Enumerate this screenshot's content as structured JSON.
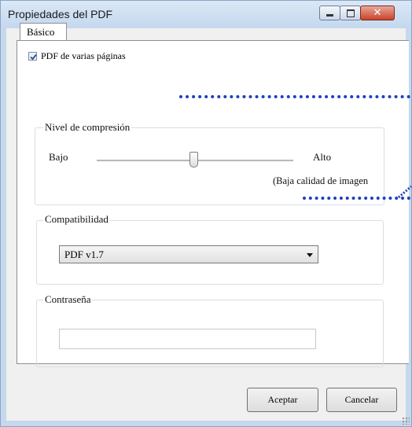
{
  "window": {
    "title": "Propiedades del PDF"
  },
  "tabs": [
    {
      "label": "Básico"
    }
  ],
  "multipage": {
    "label": "PDF de varias páginas",
    "checked": true
  },
  "compression": {
    "legend": "Nivel de compresión",
    "low_label": "Bajo",
    "high_label": "Alto",
    "note": "(Baja calidad de imagen",
    "level": 0.48
  },
  "compatibility": {
    "legend": "Compatibilidad",
    "selected": "PDF v1.7"
  },
  "password": {
    "legend": "Contraseña",
    "value": ""
  },
  "buttons": {
    "ok": "Aceptar",
    "cancel": "Cancelar"
  },
  "colors": {
    "accent_dots": "#1f3fbf",
    "close_button": "#c8432a"
  }
}
